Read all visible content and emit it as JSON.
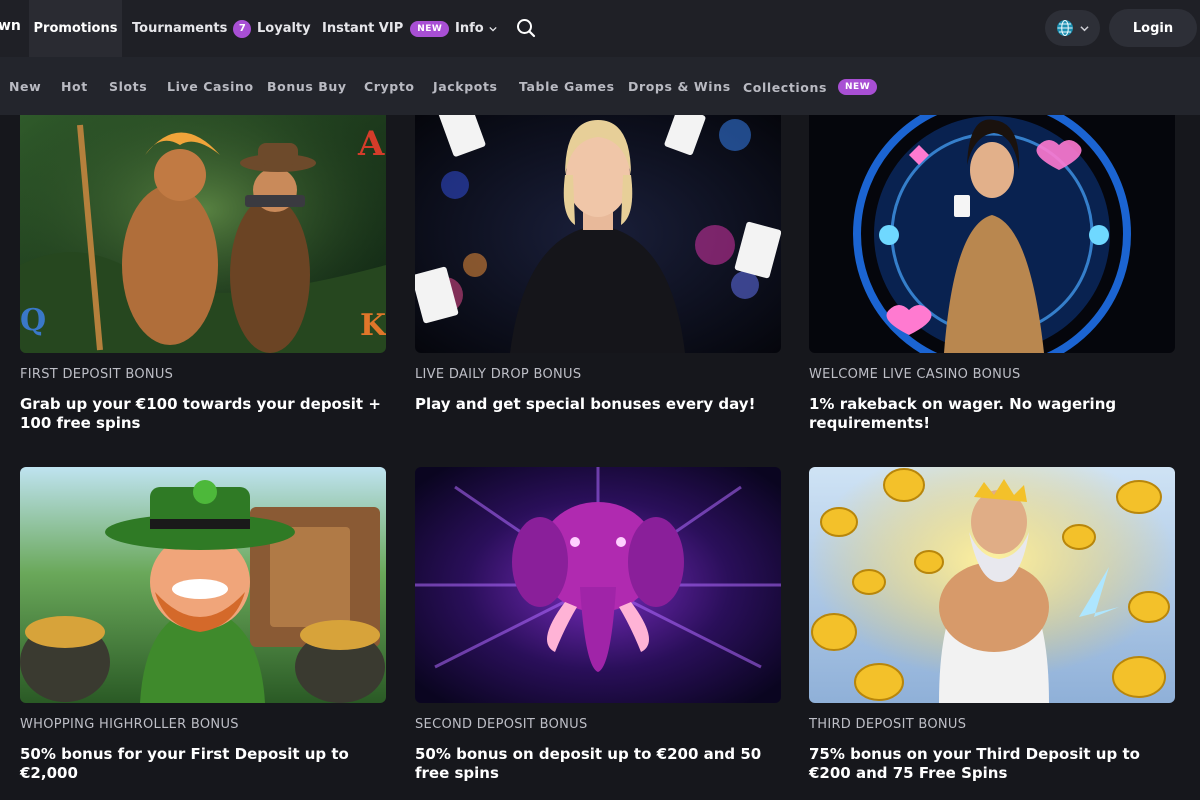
{
  "header": {
    "logo_fragment": "wn",
    "nav": [
      {
        "label": "Promotions",
        "active": true
      },
      {
        "label": "Tournaments",
        "badge": "7"
      },
      {
        "label": "Loyalty"
      },
      {
        "label": "Instant VIP",
        "badge": "NEW"
      },
      {
        "label": "Info",
        "icon": "chevron-down-icon"
      }
    ],
    "search_icon": "search-icon",
    "language_icon": "globe-icon",
    "login_label": "Login"
  },
  "categories": [
    {
      "label": "New"
    },
    {
      "label": "Hot"
    },
    {
      "label": "Slots"
    },
    {
      "label": "Live Casino"
    },
    {
      "label": "Bonus Buy"
    },
    {
      "label": "Crypto"
    },
    {
      "label": "Jackpots"
    },
    {
      "label": "Table Games"
    },
    {
      "label": "Drops & Wins"
    },
    {
      "label": "Collections",
      "badge": "NEW"
    }
  ],
  "promotions": [
    {
      "category": "FIRST DEPOSIT BONUS",
      "title": "Grab up your €100 towards your deposit + 100 free spins"
    },
    {
      "category": "LIVE DAILY DROP BONUS",
      "title": "Play and get special bonuses every day!"
    },
    {
      "category": "WELCOME LIVE CASINO BONUS",
      "title": "1% rakeback on wager. No wagering requirements!"
    },
    {
      "category": "WHOPPING HIGHROLLER BONUS",
      "title": "50% bonus for your First Deposit up to €2,000"
    },
    {
      "category": "SECOND DEPOSIT BONUS",
      "title": "50% bonus on deposit up to €200 and 50 free spins"
    },
    {
      "category": "THIRD DEPOSIT BONUS",
      "title": "75% bonus on your Third Deposit up to €200 and 75 Free Spins"
    }
  ],
  "colors": {
    "background": "#16171c",
    "topbar": "#1f2026",
    "catbar": "#23252c",
    "accent_badge": "#a84fd4"
  }
}
